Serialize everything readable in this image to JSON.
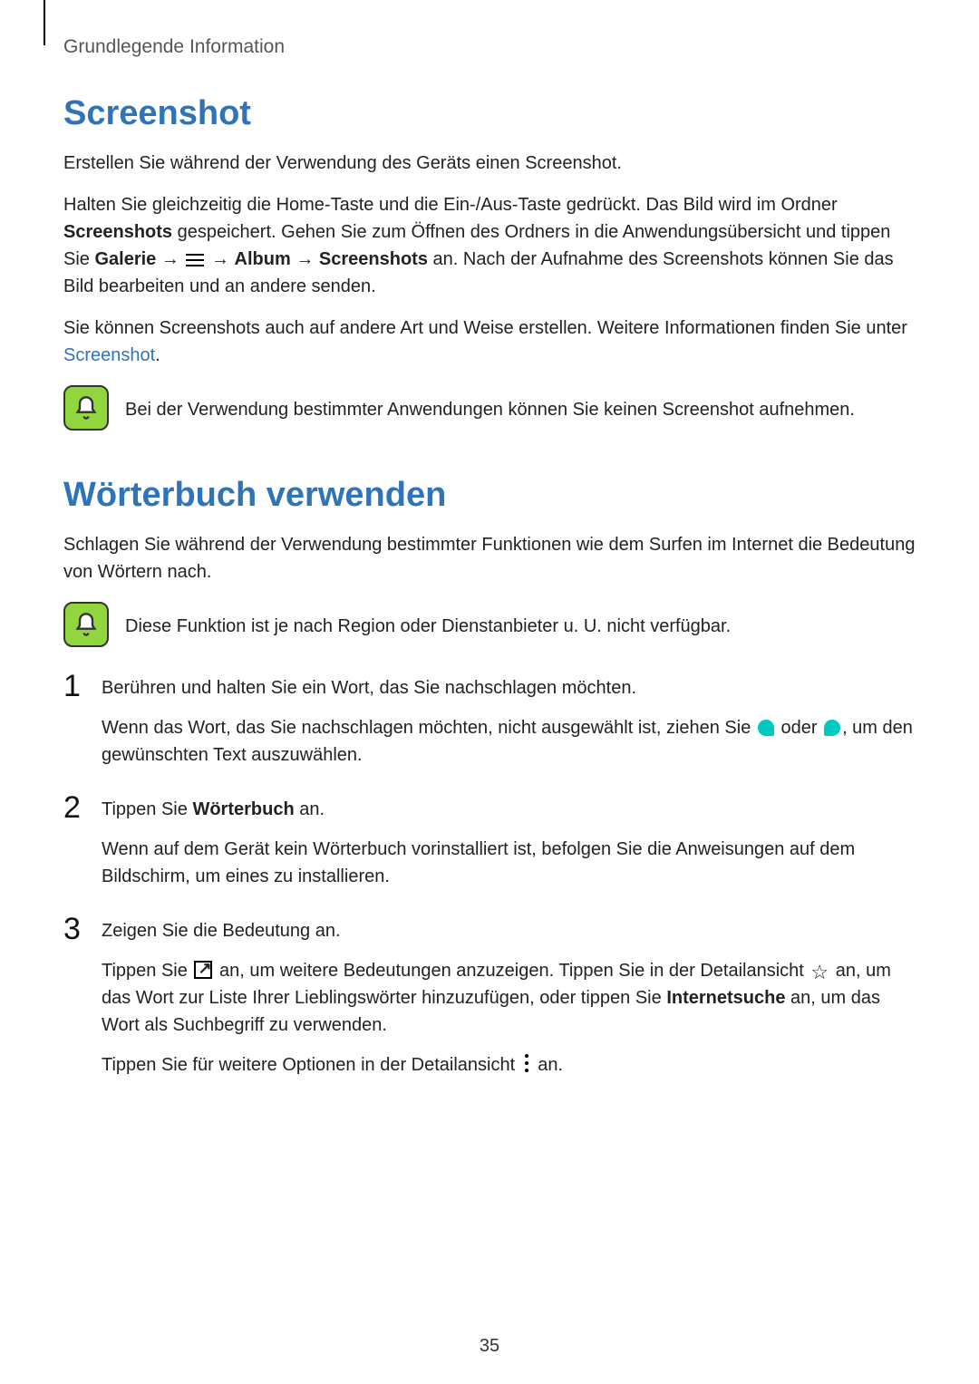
{
  "header": {
    "breadcrumb": "Grundlegende Information"
  },
  "sections": {
    "screenshot": {
      "title": "Screenshot",
      "p1": "Erstellen Sie während der Verwendung des Geräts einen Screenshot.",
      "p2a": "Halten Sie gleichzeitig die Home-Taste und die Ein-/Aus-Taste gedrückt. Das Bild wird im Ordner ",
      "p2b_bold": "Screenshots",
      "p2c": " gespeichert. Gehen Sie zum Öffnen des Ordners in die Anwendungsübersicht und tippen Sie ",
      "p2d_bold": "Galerie",
      "arrow": " → ",
      "p2e_bold": "Album",
      "p2f_bold": "Screenshots",
      "p2g": " an. Nach der Aufnahme des Screenshots können Sie das Bild bearbeiten und an andere senden.",
      "p3a": "Sie können Screenshots auch auf andere Art und Weise erstellen. Weitere Informationen finden Sie unter ",
      "p3_link": "Screenshot",
      "p3b": ".",
      "note": "Bei der Verwendung bestimmter Anwendungen können Sie keinen Screenshot aufnehmen."
    },
    "dictionary": {
      "title": "Wörterbuch verwenden",
      "intro": "Schlagen Sie während der Verwendung bestimmter Funktionen wie dem Surfen im Internet die Bedeutung von Wörtern nach.",
      "note": "Diese Funktion ist je nach Region oder Dienstanbieter u. U. nicht verfügbar.",
      "step1": {
        "line1": "Berühren und halten Sie ein Wort, das Sie nachschlagen möchten.",
        "line2a": "Wenn das Wort, das Sie nachschlagen möchten, nicht ausgewählt ist, ziehen Sie ",
        "line2b": " oder ",
        "line2c": ", um den gewünschten Text auszuwählen."
      },
      "step2": {
        "line1a": "Tippen Sie ",
        "line1b_bold": "Wörterbuch",
        "line1c": " an.",
        "line2": "Wenn auf dem Gerät kein Wörterbuch vorinstalliert ist, befolgen Sie die Anweisungen auf dem Bildschirm, um eines zu installieren."
      },
      "step3": {
        "line1": "Zeigen Sie die Bedeutung an.",
        "line2a": "Tippen Sie ",
        "line2b": " an, um weitere Bedeutungen anzuzeigen. Tippen Sie in der Detailansicht ",
        "line2c": " an, um das Wort zur Liste Ihrer Lieblingswörter hinzuzufügen, oder tippen Sie ",
        "line2d_bold": "Internetsuche",
        "line2e": " an, um das Wort als Suchbegriff zu verwenden.",
        "line3a": "Tippen Sie für weitere Optionen in der Detailansicht ",
        "line3b": " an."
      }
    }
  },
  "page_number": "35"
}
